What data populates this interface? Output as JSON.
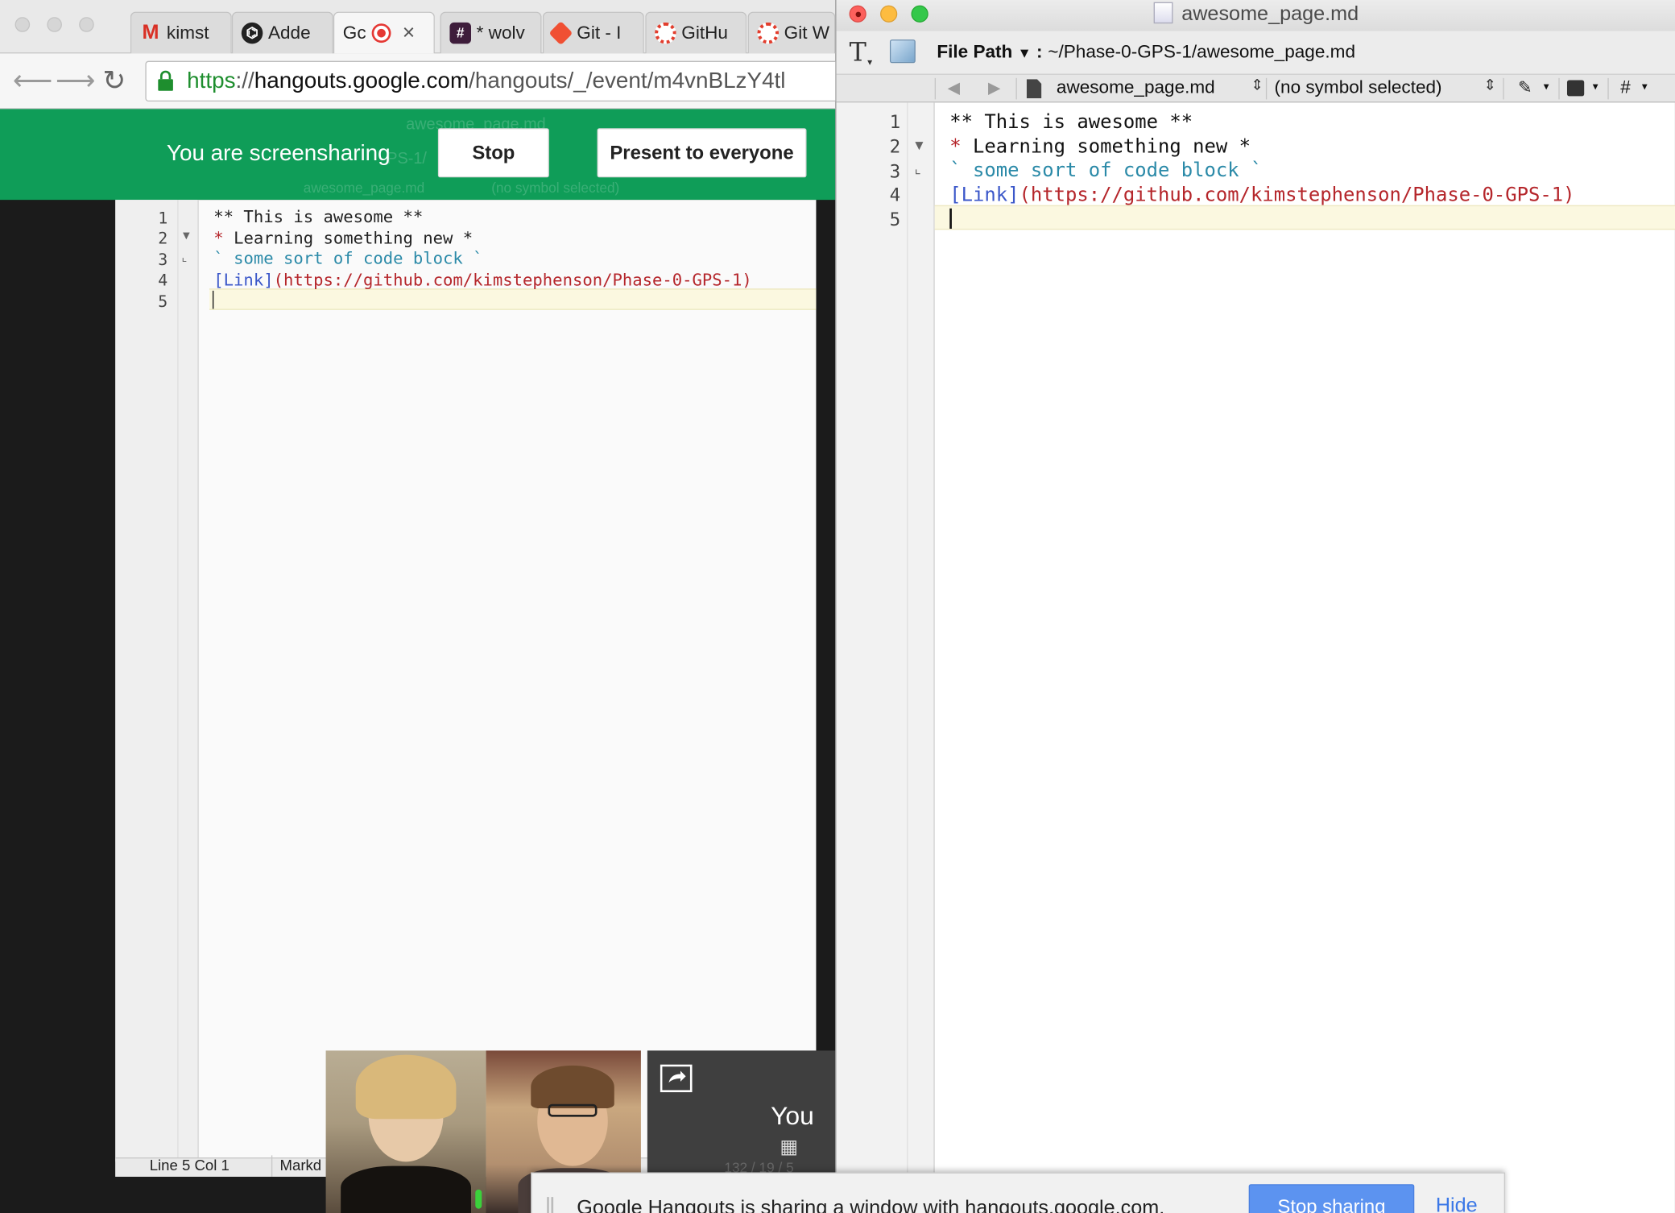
{
  "browser": {
    "tabs": [
      {
        "label": "kimst",
        "icon": "gmail-icon",
        "color": "#d93025"
      },
      {
        "label": "Adde",
        "icon": "github-icon",
        "color": "#222222"
      },
      {
        "label": "Gc",
        "icon": "record-icon",
        "color": "#e53935",
        "active": true,
        "close": "×"
      },
      {
        "label": "* wolv",
        "icon": "slack-hash-icon",
        "color": "#3e1d3b"
      },
      {
        "label": "Git - I",
        "icon": "git-icon",
        "color": "#f05033"
      },
      {
        "label": "GitHu",
        "icon": "canvas-icon",
        "color": "#e23d2d"
      },
      {
        "label": "Git W",
        "icon": "canvas-icon",
        "color": "#e23d2d"
      }
    ],
    "url": {
      "scheme": "https",
      "sep": "://",
      "host": "hangouts.google.com",
      "path": "/hangouts/_/event/m4vnBLzY4tl"
    }
  },
  "hangouts": {
    "sharing_text": "You are screensharing",
    "stop_label": "Stop",
    "present_label": "Present to everyone",
    "you_label": "You",
    "ghost_title": "awesome_page.md",
    "ghost_path": "PS-1/",
    "ghost_file": "awesome_page.md",
    "ghost_symbol": "(no symbol selected)"
  },
  "shared_editor": {
    "status_position": "Line 5 Col 1",
    "status_mode": "Markd",
    "status_counts": "132 / 19 / 5"
  },
  "textmate": {
    "window_title": "awesome_page.md",
    "file_path_label": "File Path",
    "file_path_sep": ":",
    "file_path": "~/Phase-0-GPS-1/awesome_page.md",
    "file_name": "awesome_page.md",
    "symbol": "(no symbol selected)",
    "hash": "#"
  },
  "code": {
    "line_numbers": [
      "1",
      "2",
      "3",
      "4",
      "5"
    ],
    "l1": "** This is awesome **",
    "l2_bullet": "*",
    "l2_text": " Learning something new *",
    "l3_tick_open": "`",
    "l3_text": " some sort of code block ",
    "l3_tick_close": "`",
    "l4_link": "[Link]",
    "l4_url": "(https://github.com/kimstephenson/Phase-0-GPS-1)"
  },
  "notification": {
    "message": "Google Hangouts is sharing a window with hangouts.google.com.",
    "stop_label": "Stop sharing",
    "hide_label": "Hide"
  },
  "colors": {
    "hangouts_green": "#0f9d58",
    "url_green": "#1e8e2e",
    "md_red": "#b5262b",
    "md_link": "#3b57c9",
    "md_code": "#2b8aa8",
    "stop_blue": "#5c93f0"
  }
}
